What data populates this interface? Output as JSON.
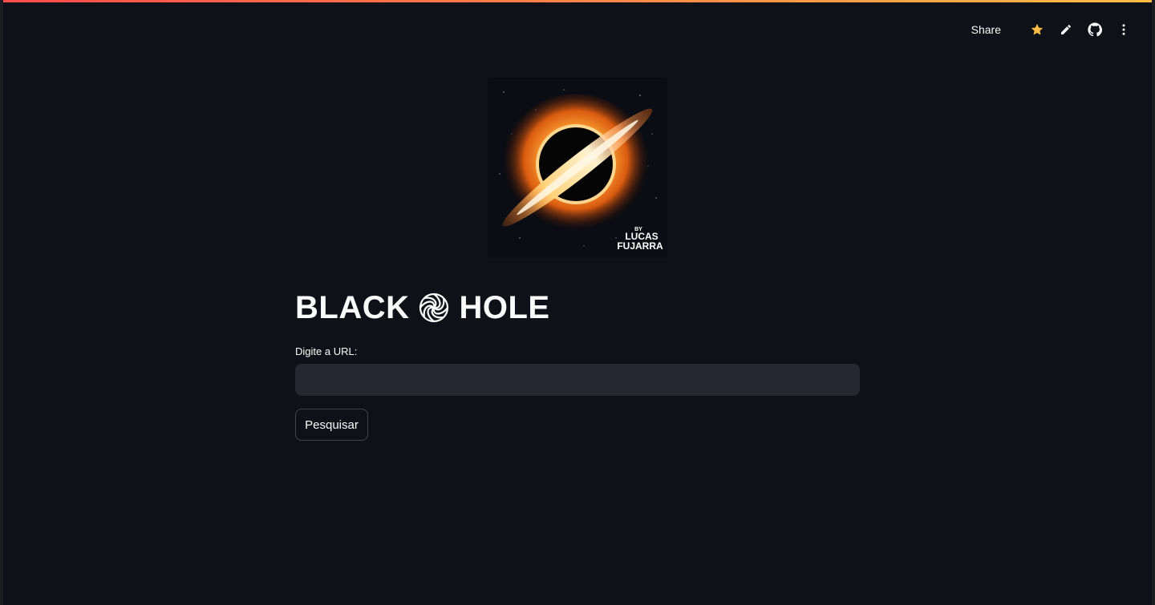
{
  "header": {
    "share_label": "Share",
    "icons": [
      "star-icon",
      "pencil-icon",
      "github-icon",
      "more-vertical-icon"
    ],
    "star_color": "#ffbd45"
  },
  "hero_image": {
    "caption_by": "BY",
    "caption_name_line1": "LUCAS",
    "caption_name_line2": "FUJARRA"
  },
  "page": {
    "title_left": "BLACK",
    "title_icon": "spiral-icon",
    "title_right": "HOLE"
  },
  "form": {
    "url_label": "Digite a URL:",
    "url_value": "",
    "url_placeholder": "",
    "submit_label": "Pesquisar"
  },
  "colors": {
    "background": "#0e1117",
    "input_bg": "#262730",
    "accent_gradient_start": "#ff4b4b",
    "accent_gradient_end": "#ffbd45"
  }
}
